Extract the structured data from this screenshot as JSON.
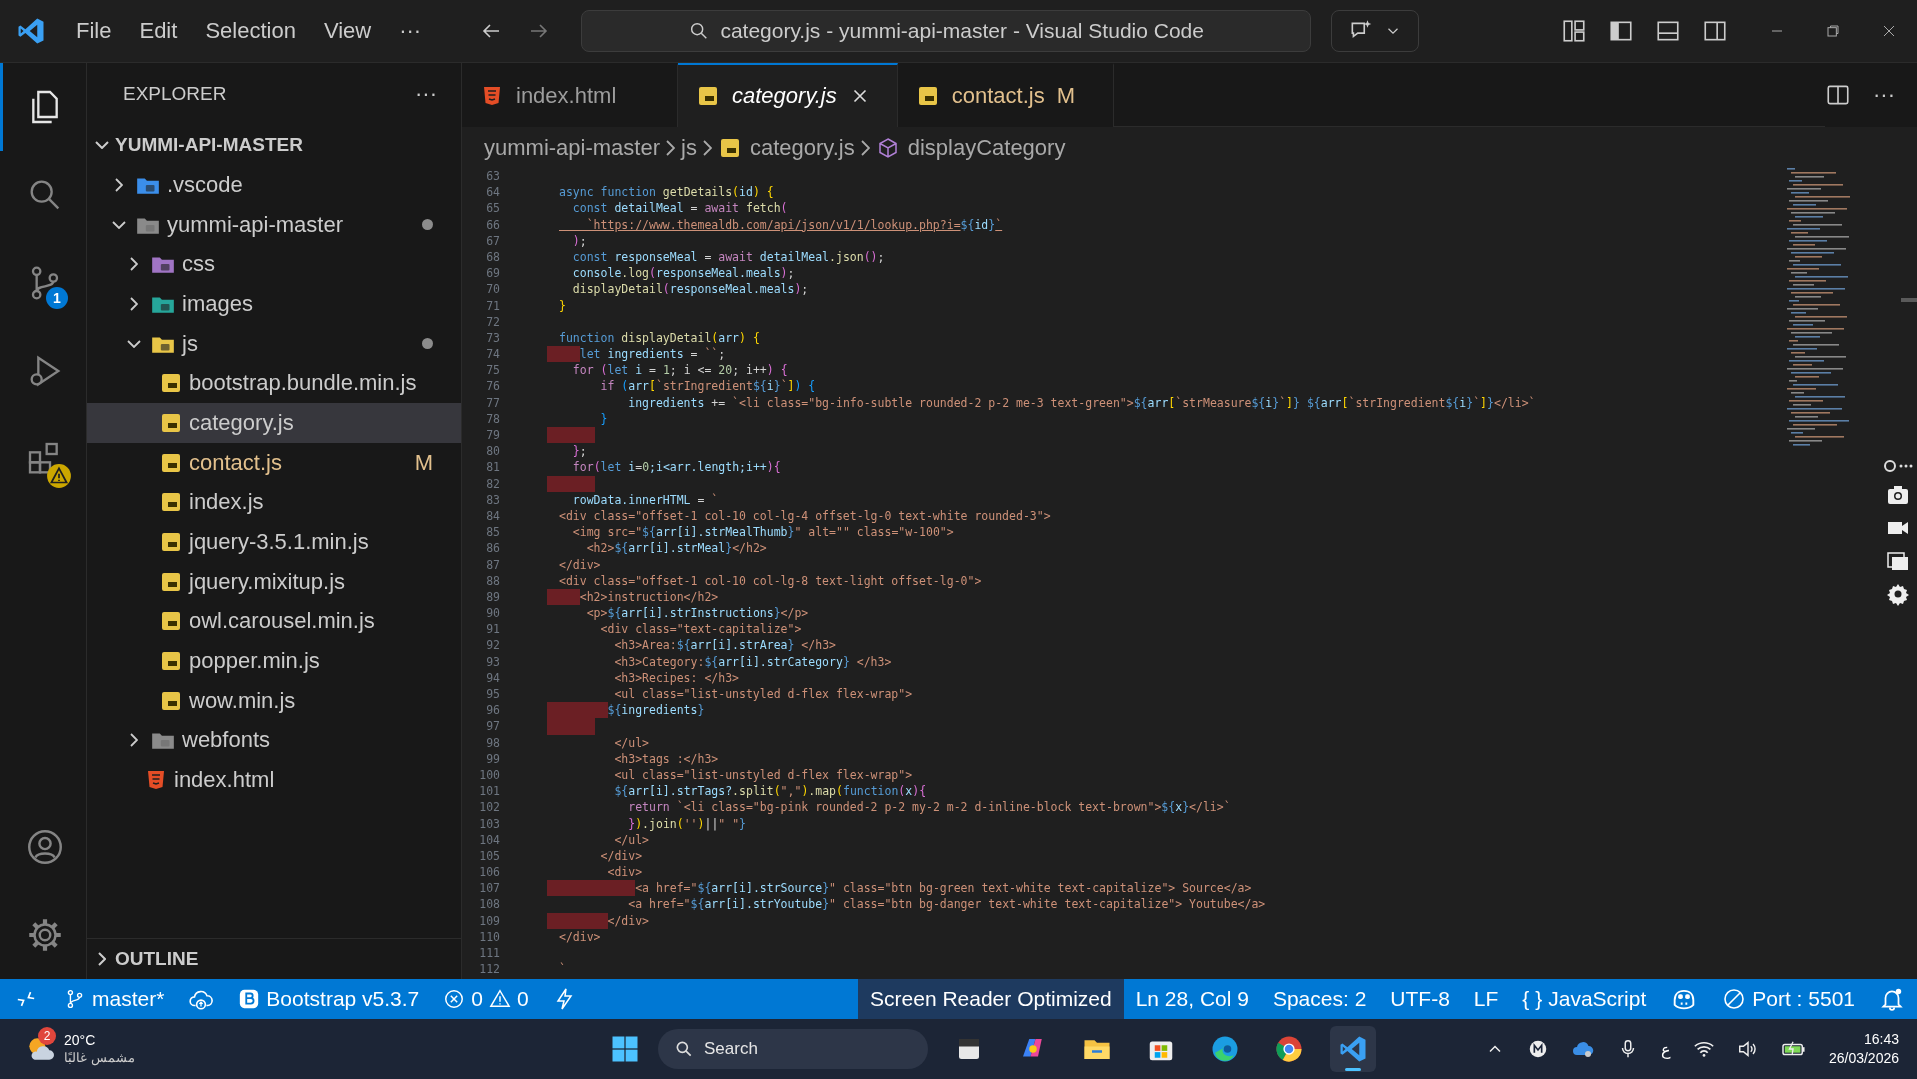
{
  "titlebar": {
    "menu": [
      "File",
      "Edit",
      "Selection",
      "View",
      "···"
    ],
    "command_center": "category.js - yummi-api-master - Visual Studio Code"
  },
  "activity": [
    {
      "kind": "explorer",
      "selected": true
    },
    {
      "kind": "search",
      "selected": false
    },
    {
      "kind": "scm",
      "selected": false,
      "badge": "1"
    },
    {
      "kind": "debug",
      "selected": false
    },
    {
      "kind": "extensions",
      "selected": false,
      "warning": true
    }
  ],
  "activity_bottom": [
    {
      "kind": "account"
    },
    {
      "kind": "settings"
    }
  ],
  "explorer": {
    "title": "EXPLORER",
    "more": "···",
    "root": {
      "label": "YUMMI-API-MASTER",
      "expanded": true
    },
    "tree": [
      {
        "label": ".vscode",
        "kind": "vscode-folder",
        "expanded": false,
        "selected": false,
        "dot": false
      },
      {
        "label": "yummi-api-master",
        "kind": "folder",
        "expanded": true,
        "selected": false,
        "dot": true,
        "children": [
          {
            "label": "css",
            "kind": "css-folder",
            "expanded": false,
            "selected": false,
            "dot": false
          },
          {
            "label": "images",
            "kind": "images-folder",
            "expanded": false,
            "selected": false,
            "dot": false
          },
          {
            "label": "js",
            "kind": "js-folder",
            "expanded": true,
            "selected": false,
            "dot": true,
            "children": [
              {
                "label": "bootstrap.bundle.min.js",
                "kind": "js",
                "selected": false,
                "modified": false
              },
              {
                "label": "category.js",
                "kind": "js",
                "selected": true,
                "modified": false
              },
              {
                "label": "contact.js",
                "kind": "js",
                "selected": false,
                "modified": true,
                "badge": "M"
              },
              {
                "label": "index.js",
                "kind": "js",
                "selected": false,
                "modified": false
              },
              {
                "label": "jquery-3.5.1.min.js",
                "kind": "js",
                "selected": false,
                "modified": false
              },
              {
                "label": "jquery.mixitup.js",
                "kind": "js",
                "selected": false,
                "modified": false
              },
              {
                "label": "owl.carousel.min.js",
                "kind": "js",
                "selected": false,
                "modified": false
              },
              {
                "label": "popper.min.js",
                "kind": "js",
                "selected": false,
                "modified": false
              },
              {
                "label": "wow.min.js",
                "kind": "js",
                "selected": false,
                "modified": false
              }
            ]
          },
          {
            "label": "webfonts",
            "kind": "folder",
            "expanded": false,
            "selected": false,
            "dot": false
          },
          {
            "label": "index.html",
            "kind": "html",
            "selected": false,
            "modified": false
          }
        ]
      }
    ],
    "outline": {
      "label": "OUTLINE",
      "expanded": false
    }
  },
  "tabs": [
    {
      "label": "index.html",
      "kind": "html",
      "selected": false,
      "preview": false,
      "modified": false
    },
    {
      "label": "category.js",
      "kind": "js",
      "selected": true,
      "preview": true,
      "modified": false
    },
    {
      "label": "contact.js",
      "kind": "js",
      "selected": false,
      "preview": false,
      "modified": true,
      "badge": "M"
    }
  ],
  "tabs_more": "···",
  "breadcrumbs": [
    {
      "label": "yummi-api-master",
      "kind": "folder"
    },
    {
      "label": "js",
      "kind": "folder"
    },
    {
      "label": "category.js",
      "kind": "js"
    },
    {
      "label": "displayCategory",
      "kind": "function"
    }
  ],
  "code": [
    {
      "n": "63",
      "indent_error": false
    },
    {
      "n": "64",
      "indent_error": false,
      "segs": [
        {
          "kind": "kw",
          "text": "async function "
        },
        {
          "kind": "fn",
          "text": "getDetails"
        },
        {
          "kind": "b1",
          "text": "("
        },
        {
          "kind": "var",
          "text": "id"
        },
        {
          "kind": "b1",
          "text": ") {"
        }
      ]
    },
    {
      "n": "65",
      "indent_error": false,
      "segs": [
        {
          "kind": "kw",
          "text": "  const "
        },
        {
          "kind": "var",
          "text": "detailMeal"
        },
        {
          "kind": "tx",
          "text": " = "
        },
        {
          "kind": "ctrl",
          "text": "await "
        },
        {
          "kind": "fn",
          "text": "fetch"
        },
        {
          "kind": "b2",
          "text": "("
        }
      ]
    },
    {
      "n": "66",
      "indent_error": false,
      "segs": [
        {
          "kind": "url",
          "text": "    `https://www.themealdb.com/api/json/v1/1/lookup.php?i="
        },
        {
          "kind": "tpl",
          "text": "${"
        },
        {
          "kind": "var",
          "text": "id"
        },
        {
          "kind": "tpl",
          "text": "}"
        },
        {
          "kind": "url",
          "text": "`"
        }
      ]
    },
    {
      "n": "67",
      "indent_error": false,
      "segs": [
        {
          "kind": "b2",
          "text": "  )"
        },
        {
          "kind": "tx",
          "text": ";"
        }
      ]
    },
    {
      "n": "68",
      "indent_error": false,
      "segs": [
        {
          "kind": "kw",
          "text": "  const "
        },
        {
          "kind": "var",
          "text": "responseMeal"
        },
        {
          "kind": "tx",
          "text": " = "
        },
        {
          "kind": "ctrl",
          "text": "await "
        },
        {
          "kind": "var",
          "text": "detailMeal"
        },
        {
          "kind": "fn",
          "text": ".json"
        },
        {
          "kind": "b2",
          "text": "()"
        },
        {
          "kind": "tx",
          "text": ";"
        }
      ]
    },
    {
      "n": "69",
      "indent_error": false,
      "segs": [
        {
          "kind": "var",
          "text": "  console"
        },
        {
          "kind": "fn",
          "text": ".log"
        },
        {
          "kind": "b2",
          "text": "("
        },
        {
          "kind": "var",
          "text": "responseMeal.meals"
        },
        {
          "kind": "b2",
          "text": ")"
        },
        {
          "kind": "tx",
          "text": ";"
        }
      ]
    },
    {
      "n": "70",
      "indent_error": false,
      "segs": [
        {
          "kind": "fn",
          "text": "  displayDetail"
        },
        {
          "kind": "b2",
          "text": "("
        },
        {
          "kind": "var",
          "text": "responseMeal.meals"
        },
        {
          "kind": "b2",
          "text": ")"
        },
        {
          "kind": "tx",
          "text": ";"
        }
      ]
    },
    {
      "n": "71",
      "indent_error": false,
      "segs": [
        {
          "kind": "b1",
          "text": "}"
        }
      ]
    },
    {
      "n": "72",
      "indent_error": false
    },
    {
      "n": "73",
      "indent_error": false,
      "segs": [
        {
          "kind": "kw",
          "text": "function "
        },
        {
          "kind": "fn",
          "text": "displayDetail"
        },
        {
          "kind": "b1",
          "text": "("
        },
        {
          "kind": "var",
          "text": "arr"
        },
        {
          "kind": "b1",
          "text": ") {"
        }
      ]
    },
    {
      "n": "74",
      "indent_error": true,
      "segs": [
        {
          "kind": "kw",
          "text": "   let "
        },
        {
          "kind": "var",
          "text": "ingredients"
        },
        {
          "kind": "tx",
          "text": " = "
        },
        {
          "kind": "str",
          "text": "``"
        },
        {
          "kind": "tx",
          "text": ";"
        }
      ]
    },
    {
      "n": "75",
      "indent_error": false,
      "segs": [
        {
          "kind": "ctrl",
          "text": "  for "
        },
        {
          "kind": "b2",
          "text": "("
        },
        {
          "kind": "kw",
          "text": "let "
        },
        {
          "kind": "var",
          "text": "i"
        },
        {
          "kind": "tx",
          "text": " = "
        },
        {
          "kind": "num",
          "text": "1"
        },
        {
          "kind": "tx",
          "text": "; i <= "
        },
        {
          "kind": "num",
          "text": "20"
        },
        {
          "kind": "tx",
          "text": "; i++"
        },
        {
          "kind": "b2",
          "text": ") {"
        }
      ]
    },
    {
      "n": "76",
      "indent_error": false,
      "segs": [
        {
          "kind": "ctrl",
          "text": "      if "
        },
        {
          "kind": "b3",
          "text": "("
        },
        {
          "kind": "var",
          "text": "arr"
        },
        {
          "kind": "b1",
          "text": "["
        },
        {
          "kind": "str",
          "text": "`strIngredient"
        },
        {
          "kind": "tpl",
          "text": "${"
        },
        {
          "kind": "var",
          "text": "i"
        },
        {
          "kind": "tpl",
          "text": "}"
        },
        {
          "kind": "str",
          "text": "`"
        },
        {
          "kind": "b1",
          "text": "]"
        },
        {
          "kind": "b3",
          "text": ") {"
        }
      ]
    },
    {
      "n": "77",
      "indent_error": false,
      "segs": [
        {
          "kind": "var",
          "text": "          ingredients"
        },
        {
          "kind": "tx",
          "text": " += "
        },
        {
          "kind": "str",
          "text": "`<li class=\"bg-info-subtle rounded-2 p-2 me-3 text-green\">"
        },
        {
          "kind": "tpl",
          "text": "${"
        },
        {
          "kind": "var",
          "text": "arr"
        },
        {
          "kind": "b1",
          "text": "["
        },
        {
          "kind": "str",
          "text": "`strMeasure"
        },
        {
          "kind": "tpl",
          "text": "${"
        },
        {
          "kind": "var",
          "text": "i"
        },
        {
          "kind": "tpl",
          "text": "}"
        },
        {
          "kind": "str",
          "text": "`"
        },
        {
          "kind": "b1",
          "text": "]"
        },
        {
          "kind": "tpl",
          "text": "} ${"
        },
        {
          "kind": "var",
          "text": "arr"
        },
        {
          "kind": "b1",
          "text": "["
        },
        {
          "kind": "str",
          "text": "`strIngredient"
        },
        {
          "kind": "tpl",
          "text": "${"
        },
        {
          "kind": "var",
          "text": "i"
        },
        {
          "kind": "tpl",
          "text": "}"
        },
        {
          "kind": "str",
          "text": "`"
        },
        {
          "kind": "b1",
          "text": "]"
        },
        {
          "kind": "tpl",
          "text": "}"
        },
        {
          "kind": "str",
          "text": "</li>`"
        }
      ]
    },
    {
      "n": "78",
      "indent_error": false,
      "segs": [
        {
          "kind": "b3",
          "text": "      }"
        }
      ]
    },
    {
      "n": "79",
      "indent_error": true
    },
    {
      "n": "80",
      "indent_error": false,
      "segs": [
        {
          "kind": "b2",
          "text": "  }"
        },
        {
          "kind": "tx",
          "text": ";"
        }
      ]
    },
    {
      "n": "81",
      "indent_error": false,
      "segs": [
        {
          "kind": "ctrl",
          "text": "  for"
        },
        {
          "kind": "b2",
          "text": "("
        },
        {
          "kind": "kw",
          "text": "let "
        },
        {
          "kind": "var",
          "text": "i"
        },
        {
          "kind": "tx",
          "text": "="
        },
        {
          "kind": "num",
          "text": "0"
        },
        {
          "kind": "var",
          "text": ";i<arr.length;i++"
        },
        {
          "kind": "b2",
          "text": "){"
        }
      ]
    },
    {
      "n": "82",
      "indent_error": true
    },
    {
      "n": "83",
      "indent_error": false,
      "segs": [
        {
          "kind": "var",
          "text": "  rowData.innerHTML"
        },
        {
          "kind": "tx",
          "text": " = "
        },
        {
          "kind": "str",
          "text": "`"
        }
      ]
    },
    {
      "n": "84",
      "indent_error": false,
      "segs": [
        {
          "kind": "str",
          "text": "<div class=\"offset-1 col-10 col-lg-4 offset-lg-0 text-white rounded-3\">"
        }
      ]
    },
    {
      "n": "85",
      "indent_error": false,
      "segs": [
        {
          "kind": "str",
          "text": "  <img src=\""
        },
        {
          "kind": "tpl",
          "text": "${"
        },
        {
          "kind": "var",
          "text": "arr[i].strMealThumb"
        },
        {
          "kind": "tpl",
          "text": "}"
        },
        {
          "kind": "str",
          "text": "\" alt=\"\" class=\"w-100\">"
        }
      ]
    },
    {
      "n": "86",
      "indent_error": false,
      "segs": [
        {
          "kind": "str",
          "text": "    <h2>"
        },
        {
          "kind": "tpl",
          "text": "${"
        },
        {
          "kind": "var",
          "text": "arr[i].strMeal"
        },
        {
          "kind": "tpl",
          "text": "}"
        },
        {
          "kind": "str",
          "text": "</h2>"
        }
      ]
    },
    {
      "n": "87",
      "indent_error": false,
      "segs": [
        {
          "kind": "str",
          "text": "</div>"
        }
      ]
    },
    {
      "n": "88",
      "indent_error": false,
      "segs": [
        {
          "kind": "str",
          "text": "<div class=\"offset-1 col-10 col-lg-8 text-light offset-lg-0\">"
        }
      ]
    },
    {
      "n": "89",
      "indent_error": true,
      "segs": [
        {
          "kind": "str",
          "text": "   <h2>instruction</h2>"
        }
      ]
    },
    {
      "n": "90",
      "indent_error": false,
      "segs": [
        {
          "kind": "str",
          "text": "    <p>"
        },
        {
          "kind": "tpl",
          "text": "${"
        },
        {
          "kind": "var",
          "text": "arr[i].strInstructions"
        },
        {
          "kind": "tpl",
          "text": "}"
        },
        {
          "kind": "str",
          "text": "</p>"
        }
      ]
    },
    {
      "n": "91",
      "indent_error": false,
      "segs": [
        {
          "kind": "str",
          "text": "      <div class=\"text-capitalize\">"
        }
      ]
    },
    {
      "n": "92",
      "indent_error": false,
      "segs": [
        {
          "kind": "str",
          "text": "        <h3>Area:"
        },
        {
          "kind": "tpl",
          "text": "${"
        },
        {
          "kind": "var",
          "text": "arr[i].strArea"
        },
        {
          "kind": "tpl",
          "text": "}"
        },
        {
          "kind": "str",
          "text": " </h3>"
        }
      ]
    },
    {
      "n": "93",
      "indent_error": false,
      "segs": [
        {
          "kind": "str",
          "text": "        <h3>Category:"
        },
        {
          "kind": "tpl",
          "text": "${"
        },
        {
          "kind": "var",
          "text": "arr[i].strCategory"
        },
        {
          "kind": "tpl",
          "text": "}"
        },
        {
          "kind": "str",
          "text": " </h3>"
        }
      ]
    },
    {
      "n": "94",
      "indent_error": false,
      "segs": [
        {
          "kind": "str",
          "text": "        <h3>Recipes: </h3>"
        }
      ]
    },
    {
      "n": "95",
      "indent_error": false,
      "segs": [
        {
          "kind": "str",
          "text": "        <ul class=\"list-unstyled d-flex flex-wrap\">"
        }
      ]
    },
    {
      "n": "96",
      "indent_error": true,
      "segs": [
        {
          "kind": "tpl",
          "text": "       ${"
        },
        {
          "kind": "var",
          "text": "ingredients"
        },
        {
          "kind": "tpl",
          "text": "}"
        }
      ]
    },
    {
      "n": "97",
      "indent_error": true
    },
    {
      "n": "98",
      "indent_error": false,
      "segs": [
        {
          "kind": "str",
          "text": "        </ul>"
        }
      ]
    },
    {
      "n": "99",
      "indent_error": false,
      "segs": [
        {
          "kind": "str",
          "text": "        <h3>tags :</h3>"
        }
      ]
    },
    {
      "n": "100",
      "indent_error": false,
      "segs": [
        {
          "kind": "str",
          "text": "        <ul class=\"list-unstyled d-flex flex-wrap\">"
        }
      ]
    },
    {
      "n": "101",
      "indent_error": false,
      "segs": [
        {
          "kind": "tpl",
          "text": "        ${"
        },
        {
          "kind": "var",
          "text": "arr[i].strTags?"
        },
        {
          "kind": "fn",
          "text": ".split"
        },
        {
          "kind": "b1",
          "text": "("
        },
        {
          "kind": "str",
          "text": "\",\""
        },
        {
          "kind": "b1",
          "text": ")"
        },
        {
          "kind": "fn",
          "text": ".map"
        },
        {
          "kind": "b1",
          "text": "("
        },
        {
          "kind": "kw",
          "text": "function"
        },
        {
          "kind": "b2",
          "text": "("
        },
        {
          "kind": "var",
          "text": "x"
        },
        {
          "kind": "b2",
          "text": "){"
        }
      ]
    },
    {
      "n": "102",
      "indent_error": false,
      "segs": [
        {
          "kind": "ctrl",
          "text": "          return "
        },
        {
          "kind": "str",
          "text": "`<li class=\"bg-pink rounded-2 p-2 my-2 m-2 d-inline-block text-brown\">"
        },
        {
          "kind": "tpl",
          "text": "${"
        },
        {
          "kind": "var",
          "text": "x"
        },
        {
          "kind": "tpl",
          "text": "}"
        },
        {
          "kind": "str",
          "text": "</li>`"
        }
      ]
    },
    {
      "n": "103",
      "indent_error": false,
      "segs": [
        {
          "kind": "b2",
          "text": "          }"
        },
        {
          "kind": "b1",
          "text": ")"
        },
        {
          "kind": "fn",
          "text": ".join"
        },
        {
          "kind": "b1",
          "text": "("
        },
        {
          "kind": "str",
          "text": "''"
        },
        {
          "kind": "b1",
          "text": ")"
        },
        {
          "kind": "tx",
          "text": "||"
        },
        {
          "kind": "str",
          "text": "\" \""
        },
        {
          "kind": "tpl",
          "text": "}"
        }
      ]
    },
    {
      "n": "104",
      "indent_error": false,
      "segs": [
        {
          "kind": "str",
          "text": "        </ul>"
        }
      ]
    },
    {
      "n": "105",
      "indent_error": false,
      "segs": [
        {
          "kind": "str",
          "text": "      </div>"
        }
      ]
    },
    {
      "n": "106",
      "indent_error": false,
      "segs": [
        {
          "kind": "str",
          "text": "       <div>"
        }
      ]
    },
    {
      "n": "107",
      "indent_error": true,
      "segs": [
        {
          "kind": "str",
          "text": "           <a href=\""
        },
        {
          "kind": "tpl",
          "text": "${"
        },
        {
          "kind": "var",
          "text": "arr[i].strSource"
        },
        {
          "kind": "tpl",
          "text": "}"
        },
        {
          "kind": "str",
          "text": "\" class=\"btn bg-green text-white text-capitalize\"> Source</a>"
        }
      ]
    },
    {
      "n": "108",
      "indent_error": false,
      "segs": [
        {
          "kind": "str",
          "text": "          <a href=\""
        },
        {
          "kind": "tpl",
          "text": "${"
        },
        {
          "kind": "var",
          "text": "arr[i].strYoutube"
        },
        {
          "kind": "tpl",
          "text": "}"
        },
        {
          "kind": "str",
          "text": "\" class=\"btn bg-danger text-white text-capitalize\"> Youtube</a>"
        }
      ]
    },
    {
      "n": "109",
      "indent_error": true,
      "segs": [
        {
          "kind": "str",
          "text": "       </div>"
        }
      ]
    },
    {
      "n": "110",
      "indent_error": false,
      "segs": [
        {
          "kind": "str",
          "text": "</div>"
        }
      ]
    },
    {
      "n": "111",
      "indent_error": false
    },
    {
      "n": "112",
      "indent_error": false,
      "segs": [
        {
          "kind": "str",
          "text": "`"
        }
      ]
    }
  ],
  "status_left": [
    {
      "kind": "remote"
    },
    {
      "kind": "branch",
      "text": "master*"
    },
    {
      "kind": "sync"
    },
    {
      "kind": "bootstrap",
      "text": "Bootstrap v5.3.7"
    },
    {
      "kind": "problems",
      "errors": "0",
      "warnings": "0"
    },
    {
      "kind": "bolt"
    }
  ],
  "status_right": [
    {
      "kind": "text",
      "text": "Screen Reader Optimized",
      "highlight": true
    },
    {
      "kind": "text",
      "text": "Ln 28, Col 9",
      "highlight": false
    },
    {
      "kind": "text",
      "text": "Spaces: 2",
      "highlight": false
    },
    {
      "kind": "text",
      "text": "UTF-8",
      "highlight": false
    },
    {
      "kind": "text",
      "text": "LF",
      "highlight": false
    },
    {
      "kind": "language",
      "icon_text": "{ }",
      "text": "JavaScript"
    },
    {
      "kind": "copilot"
    },
    {
      "kind": "port",
      "text": "Port : 5501"
    },
    {
      "kind": "bell"
    }
  ],
  "taskbar": {
    "weather": {
      "badge": "2",
      "temp": "20°C",
      "text": "مشمس غالبًا"
    },
    "search": {
      "placeholder": "Search"
    },
    "apps": [
      {
        "kind": "widget",
        "active": false
      },
      {
        "kind": "copilot",
        "active": false
      },
      {
        "kind": "files",
        "active": false
      },
      {
        "kind": "store",
        "active": false
      },
      {
        "kind": "edge",
        "active": false
      },
      {
        "kind": "chrome",
        "active": false
      },
      {
        "kind": "vscode",
        "active": true
      }
    ],
    "language": "ع",
    "time": "16:43",
    "date": "26/03/2026"
  }
}
